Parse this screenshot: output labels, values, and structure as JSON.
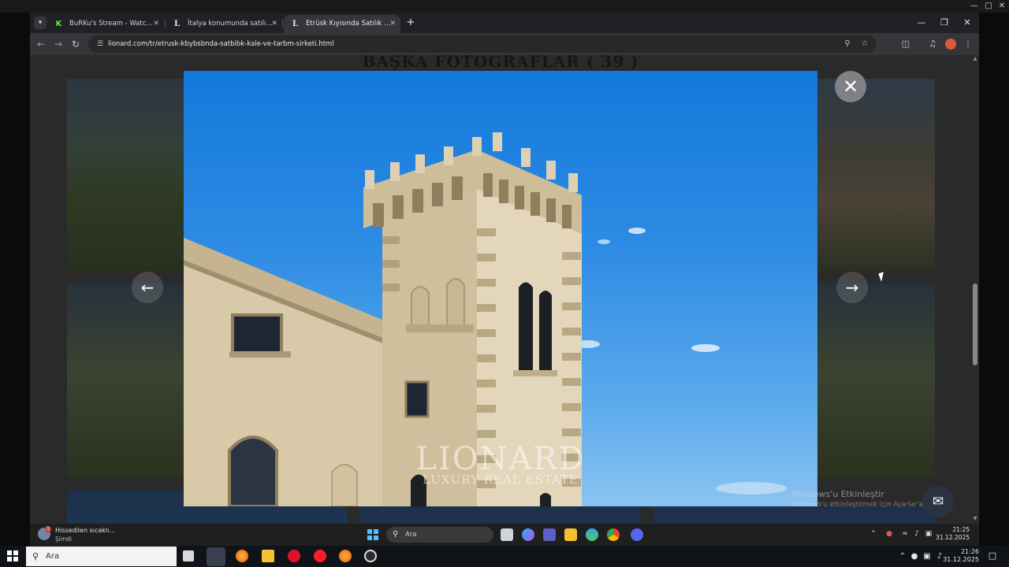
{
  "browser": {
    "tabs": [
      {
        "label": "BuRKu's Stream - Watch Live o",
        "favicon": "K",
        "active": false
      },
      {
        "label": "İtalya konumunda satılık ŞATO",
        "favicon": "L",
        "active": false
      },
      {
        "label": "Etrüsk Kıyısında Satılık Kale Ve",
        "favicon": "L",
        "active": true
      }
    ],
    "new_tab_label": "+",
    "url": "lionard.com/tr/etrusk-kbybsbnda-satbibk-kale-ve-tarbm-sirketi.html"
  },
  "page": {
    "heading": "BAŞKA FOTOĞRAFLAR ( 39 )",
    "watermark_name": "LIONARD",
    "watermark_sub": "LUXURY REAL ESTATE",
    "activation_title": "Windows'u Etkinleştir",
    "activation_sub": "Windows'u etkinleştirmek için Ayarlar'a gidin."
  },
  "inner_taskbar": {
    "weather_text": "Hissedilen sıcaklı...",
    "weather_sub": "Şimdi",
    "weather_badge": "1",
    "search_placeholder": "Ara",
    "time": "21:25",
    "date": "31.12.2025"
  },
  "outer_taskbar": {
    "search_placeholder": "Ara",
    "time": "21:26",
    "date": "31.12.2025"
  }
}
